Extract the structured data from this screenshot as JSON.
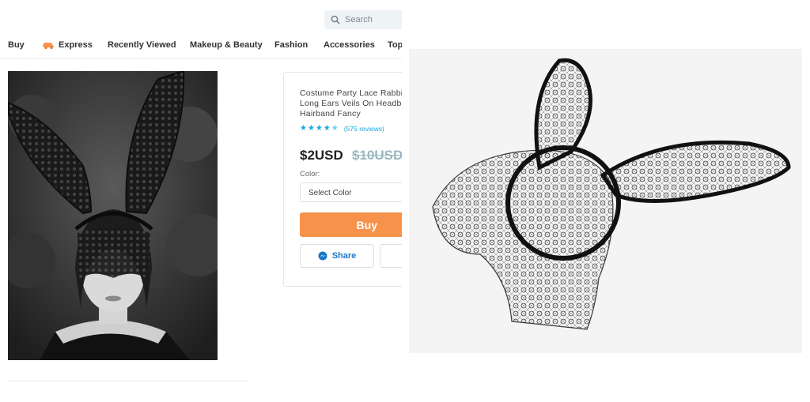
{
  "search": {
    "placeholder": "Search"
  },
  "nav": {
    "items": [
      "Buy",
      "Express",
      "Recently Viewed",
      "Makeup & Beauty",
      "Fashion",
      "Accessories",
      "Top"
    ]
  },
  "product": {
    "title": "Costume Party Lace Rabbi\nLong Ears Veils On Headb\nHairband Fancy",
    "rating": 4.5,
    "reviews": "(575 reviews)",
    "price": "$2USD",
    "old_price": "$10USD",
    "color_label": "Color:",
    "color_select": "Select Color",
    "buy_label": "Buy",
    "share_label": "Share"
  },
  "colors": {
    "accent_orange": "#f7924b",
    "link_blue": "#1aa8e0",
    "share_blue": "#1c76c9"
  },
  "icons": [
    "search-icon",
    "express-icon",
    "star-icon",
    "messenger-icon"
  ]
}
